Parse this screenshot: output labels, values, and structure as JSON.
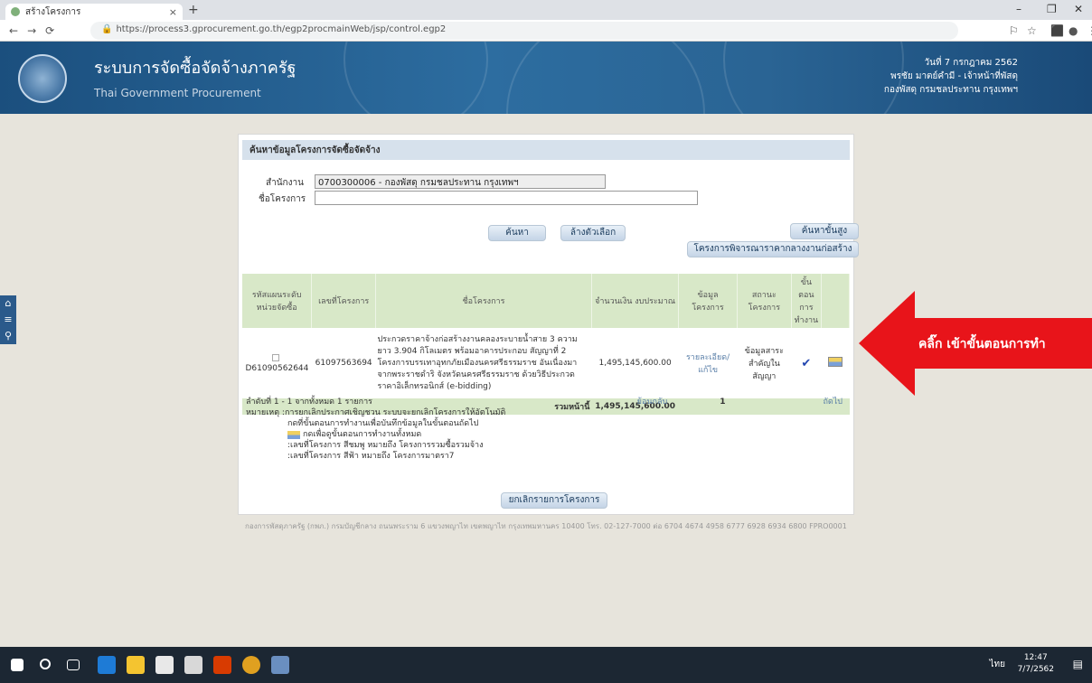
{
  "browser": {
    "tab_title": "สร้างโครงการ",
    "url": "https://process3.gprocurement.go.th/egp2procmainWeb/jsp/control.egp2"
  },
  "header": {
    "title": "ระบบการจัดซื้อจัดจ้างภาครัฐ",
    "subtitle": "Thai Government Procurement",
    "date": "วันที่ 7 กรกฎาคม 2562",
    "user": "พรชัย มาตย์คำมี - เจ้าหน้าที่พัสดุ",
    "agency": "กองพัสดุ กรมชลประทาน กรุงเทพฯ"
  },
  "search": {
    "heading": "ค้นหาข้อมูลโครงการจัดซื้อจัดจ้าง",
    "office_label": "สำนักงาน",
    "office_value": "0700300006 - กองพัสดุ กรมชลประทาน กรุงเทพฯ",
    "project_label": "ชื่อโครงการ",
    "project_value": "",
    "btn_search": "ค้นหา",
    "btn_clear": "ล้างตัวเลือก",
    "btn_advanced": "ค้นหาขั้นสูง",
    "btn_consider": "โครงการพิจารณาราคากลางงานก่อสร้าง"
  },
  "table": {
    "headers": [
      "รหัสแผนระดับ หน่วยจัดซื้อ",
      "เลขที่โครงการ",
      "ชื่อโครงการ",
      "จำนวนเงิน งบประมาณ",
      "ข้อมูล โครงการ",
      "สถานะ โครงการ",
      "ขั้น ตอน การ ทำงาน"
    ],
    "rows": [
      {
        "plan_id": "D61090562644",
        "project_no": "61097563694",
        "name": "ประกวดราคาจ้างก่อสร้างงานคลองระบายน้ำสาย 3 ความยาว 3.904 กิโลเมตร พร้อมอาคารประกอบ สัญญาที่ 2 โครงการบรรเทาอุทกภัยเมืองนครศรีธรรมราช อันเนื่องมาจากพระราชดำริ จังหวัดนครศรีธรรมราช ด้วยวิธีประกวดราคาอิเล็กทรอนิกส์ (e-bidding)",
        "amount": "1,495,145,600.00",
        "info": "รายละเอียด/แก้ไข",
        "status": "ข้อมูลสาระสำคัญในสัญญา"
      }
    ],
    "total_label": "รวมหน้านี้",
    "total_amount": "1,495,145,600.00"
  },
  "pager": {
    "summary": "ลำดับที่ 1 - 1 จากทั้งหมด 1 รายการ",
    "prev": "ย้อนกลับ",
    "page": "1",
    "next": "ถัดไป"
  },
  "notes": {
    "line1": "หมายเหตุ :การยกเลิกประกาศเชิญชวน ระบบจะยกเลิกโครงการให้อัตโนมัติ",
    "line2": "กดที่ขั้นตอนการทำงานเพื่อบันทึกข้อมูลในขั้นตอนถัดไป",
    "line3": "กดเพื่อดูขั้นตอนการทำงานทั้งหมด",
    "line4": ":เลขที่โครงการ สีชมพู หมายถึง โครงการรวมซื้อรวมจ้าง",
    "line5": ":เลขที่โครงการ สีฟ้า หมายถึง โครงการมาตรา7",
    "btn_cancel": "ยกเลิกรายการโครงการ"
  },
  "footer": "กองการพัสดุภาครัฐ (กพภ.) กรมบัญชีกลาง ถนนพระราม 6 แขวงพญาไท เขตพญาไท กรุงเทพมหานคร 10400 โทร. 02-127-7000 ต่อ 6704 4674 4958 6777 6928 6934 6800 FPRO0001",
  "annotation": "คลิ๊ก เข้าขั้นตอนการทำ",
  "taskbar": {
    "time": "12:47",
    "date": "7/7/2562",
    "lang": "ไทย"
  },
  "colors": {
    "banner": "#2d6da0",
    "table_header": "#d8e8c8",
    "arrow": "#e8141a"
  }
}
